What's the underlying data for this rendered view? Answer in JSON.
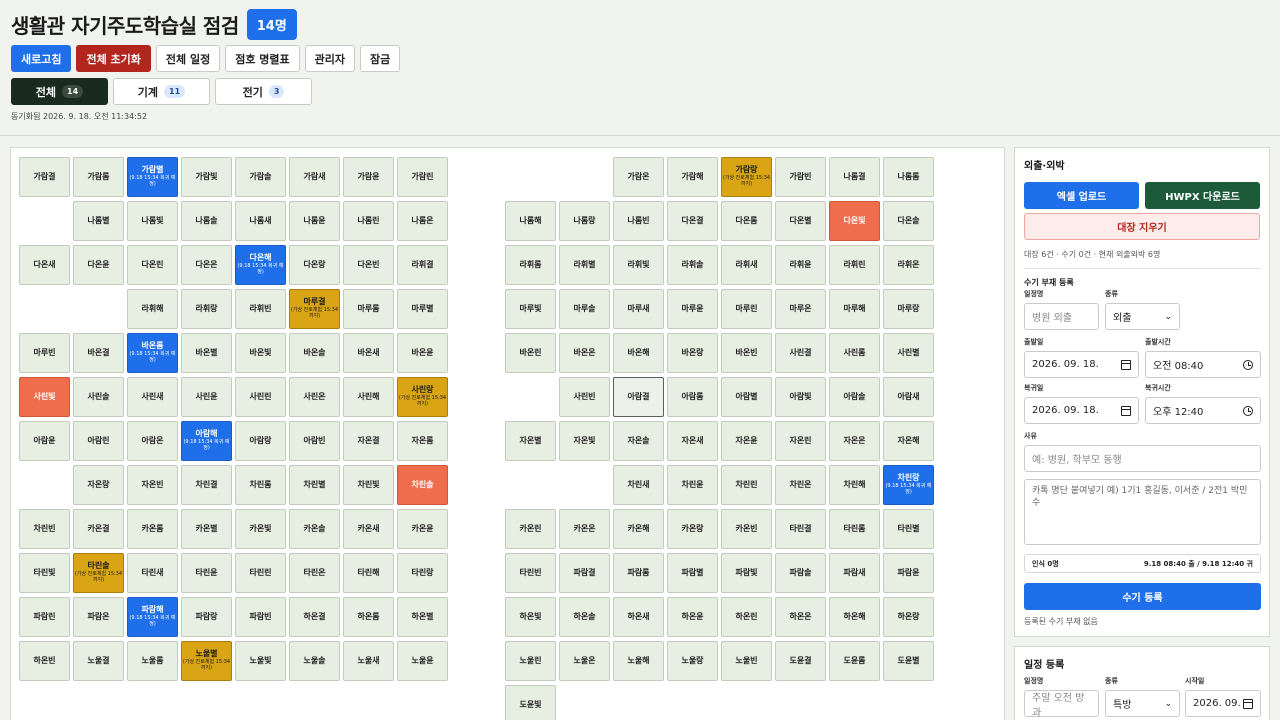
{
  "header": {
    "title": "생활관 자기주도학습실 점검",
    "count": "14명"
  },
  "toolbar": {
    "buttons": [
      "새로고침",
      "전체 초기화",
      "전체 일정",
      "점호 명렬표",
      "관리자",
      "잠금"
    ]
  },
  "filters": [
    {
      "label": "전체",
      "count": "14"
    },
    {
      "label": "기계",
      "count": "11"
    },
    {
      "label": "전기",
      "count": "3"
    }
  ],
  "sync_text": "동기화됨 2026. 9. 18. 오전 11:34:52",
  "seats": [
    {
      "n": "가람결"
    },
    {
      "n": "가람롬"
    },
    {
      "n": "가람별",
      "s": "blue",
      "sub": "(9.18 15:34 복귀 예정)"
    },
    {
      "n": "가람빛"
    },
    {
      "n": "가람솔"
    },
    {
      "n": "가람새"
    },
    {
      "n": "가람윤"
    },
    {
      "n": "가람린"
    },
    {
      "n": "가람온"
    },
    {
      "n": "가람해"
    },
    {
      "n": "가람랑",
      "s": "gold",
      "sub": "(가상 진로체험 15:34까지)"
    },
    {
      "n": "가람빈"
    },
    {
      "n": "나롬결"
    },
    {
      "n": "나롬롬"
    },
    {
      "n": "나롬별"
    },
    {
      "n": "나롬빛"
    },
    {
      "n": "나롬솔"
    },
    {
      "n": "나롬새"
    },
    {
      "n": "나롬윤"
    },
    {
      "n": "나롬린"
    },
    {
      "n": "나롬온"
    },
    {
      "n": "나롬해"
    },
    {
      "n": "나롬랑"
    },
    {
      "n": "나롬빈"
    },
    {
      "n": "다온결"
    },
    {
      "n": "다온롬"
    },
    {
      "n": "다온별"
    },
    {
      "n": "다온빛",
      "s": "coral"
    },
    {
      "n": "다온솔"
    },
    {
      "n": "다온새"
    },
    {
      "n": "다온윤"
    },
    {
      "n": "다온린"
    },
    {
      "n": "다온온"
    },
    {
      "n": "다온해",
      "s": "blue",
      "sub": "(9.18 15:34 복귀 예정)"
    },
    {
      "n": "다온랑"
    },
    {
      "n": "다온빈"
    },
    {
      "n": "라휘결"
    },
    {
      "n": "라휘롬"
    },
    {
      "n": "라휘별"
    },
    {
      "n": "라휘빛"
    },
    {
      "n": "라휘솔"
    },
    {
      "n": "라휘새"
    },
    {
      "n": "라휘윤"
    },
    {
      "n": "라휘린"
    },
    {
      "n": "라휘온"
    },
    {
      "n": "라휘해"
    },
    {
      "n": "라휘랑"
    },
    {
      "n": "라휘빈"
    },
    {
      "n": "마루결",
      "s": "gold",
      "sub": "(가상 진로체험 15:34까지)"
    },
    {
      "n": "마루롬"
    },
    {
      "n": "마루별"
    },
    {
      "n": "마루빛"
    },
    {
      "n": "마루솔"
    },
    {
      "n": "마루새"
    },
    {
      "n": "마루윤"
    },
    {
      "n": "마루린"
    },
    {
      "n": "마루온"
    },
    {
      "n": "마루해"
    },
    {
      "n": "마루랑"
    },
    {
      "n": "마루빈"
    },
    {
      "n": "바온결"
    },
    {
      "n": "바온롬",
      "s": "blue",
      "sub": "(9.18 15:34 복귀 예정)"
    },
    {
      "n": "바온별"
    },
    {
      "n": "바온빛"
    },
    {
      "n": "바온솔"
    },
    {
      "n": "바온새"
    },
    {
      "n": "바온윤"
    },
    {
      "n": "바온린"
    },
    {
      "n": "바온온"
    },
    {
      "n": "바온해"
    },
    {
      "n": "바온랑"
    },
    {
      "n": "바온빈"
    },
    {
      "n": "사린결"
    },
    {
      "n": "사린롬"
    },
    {
      "n": "사린별"
    },
    {
      "n": "사린빛",
      "s": "coral"
    },
    {
      "n": "사린솔"
    },
    {
      "n": "사린새"
    },
    {
      "n": "사린윤"
    },
    {
      "n": "사린린"
    },
    {
      "n": "사린온"
    },
    {
      "n": "사린해"
    },
    {
      "n": "사린랑",
      "s": "gold",
      "sub": "(가상 진로체험 15:34까지)"
    },
    {
      "n": "사린빈"
    },
    {
      "n": "아람결",
      "s": "out"
    },
    {
      "n": "아람롬"
    },
    {
      "n": "아람별"
    },
    {
      "n": "아람빛"
    },
    {
      "n": "아람솔"
    },
    {
      "n": "아람새"
    },
    {
      "n": "아람윤"
    },
    {
      "n": "아람린"
    },
    {
      "n": "아람온"
    },
    {
      "n": "아람해",
      "s": "blue",
      "sub": "(9.18 15:34 복귀 예정)"
    },
    {
      "n": "아람랑"
    },
    {
      "n": "아람빈"
    },
    {
      "n": "자온결"
    },
    {
      "n": "자온롬"
    },
    {
      "n": "자온별"
    },
    {
      "n": "자온빛"
    },
    {
      "n": "자온솔"
    },
    {
      "n": "자온새"
    },
    {
      "n": "자온윤"
    },
    {
      "n": "자온린"
    },
    {
      "n": "자온온"
    },
    {
      "n": "자온해"
    },
    {
      "n": "자온랑"
    },
    {
      "n": "자온빈"
    },
    {
      "n": "차린결"
    },
    {
      "n": "차린롬"
    },
    {
      "n": "차린별"
    },
    {
      "n": "차린빛"
    },
    {
      "n": "차린솔",
      "s": "coral"
    },
    {
      "n": "차린새"
    },
    {
      "n": "차린윤"
    },
    {
      "n": "차린린"
    },
    {
      "n": "차린온"
    },
    {
      "n": "차린해"
    },
    {
      "n": "차린랑",
      "s": "blue",
      "sub": "(9.18 15:34 복귀 예정)"
    },
    {
      "n": "차린빈"
    },
    {
      "n": "카온결"
    },
    {
      "n": "카온롬"
    },
    {
      "n": "카온별"
    },
    {
      "n": "카온빛"
    },
    {
      "n": "카온솔"
    },
    {
      "n": "카온새"
    },
    {
      "n": "카온윤"
    },
    {
      "n": "카온린"
    },
    {
      "n": "카온온"
    },
    {
      "n": "카온해"
    },
    {
      "n": "카온랑"
    },
    {
      "n": "카온빈"
    },
    {
      "n": "타린결"
    },
    {
      "n": "타린롬"
    },
    {
      "n": "타린별"
    },
    {
      "n": "타린빛"
    },
    {
      "n": "타린솔",
      "s": "gold",
      "sub": "(가상 진로체험 15:34까지)"
    },
    {
      "n": "타린새"
    },
    {
      "n": "타린윤"
    },
    {
      "n": "타린린"
    },
    {
      "n": "타린온"
    },
    {
      "n": "타린해"
    },
    {
      "n": "타린랑"
    },
    {
      "n": "타린빈"
    },
    {
      "n": "파람결"
    },
    {
      "n": "파람롬"
    },
    {
      "n": "파람별"
    },
    {
      "n": "파람빛"
    },
    {
      "n": "파람솔"
    },
    {
      "n": "파람새"
    },
    {
      "n": "파람윤"
    },
    {
      "n": "파람린"
    },
    {
      "n": "파람온"
    },
    {
      "n": "파람해",
      "s": "blue",
      "sub": "(9.18 15:34 복귀 예정)"
    },
    {
      "n": "파람랑"
    },
    {
      "n": "파람빈"
    },
    {
      "n": "하온결"
    },
    {
      "n": "하온롬"
    },
    {
      "n": "하온별"
    },
    {
      "n": "하온빛"
    },
    {
      "n": "하온솔"
    },
    {
      "n": "하온새"
    },
    {
      "n": "하온윤"
    },
    {
      "n": "하온린"
    },
    {
      "n": "하온온"
    },
    {
      "n": "하온해"
    },
    {
      "n": "하온랑"
    },
    {
      "n": "하온빈"
    },
    {
      "n": "노울결"
    },
    {
      "n": "노울롬"
    },
    {
      "n": "노울별",
      "s": "gold",
      "sub": "(가상 진로체험 15:34까지)"
    },
    {
      "n": "노울빛"
    },
    {
      "n": "노울솔"
    },
    {
      "n": "노울새"
    },
    {
      "n": "노울윤"
    },
    {
      "n": "노울린"
    },
    {
      "n": "노울온"
    },
    {
      "n": "노울해"
    },
    {
      "n": "노울랑"
    },
    {
      "n": "노울빈"
    },
    {
      "n": "도윤결"
    },
    {
      "n": "도윤롬"
    },
    {
      "n": "도윤별"
    },
    {
      "n": "도윤빛"
    }
  ],
  "outing": {
    "title": "외출·외박",
    "excel_label": "엑셀 업로드",
    "hwpx_label": "HWPX 다운로드",
    "clear_label": "대장 지우기",
    "summary": "대장 6건 · 수기 0건 · 현재 외출외박 6명",
    "manual_title": "수기 부재 등록",
    "event_label": "일정명",
    "event_placeholder": "병원 외출",
    "kind_label": "종류",
    "kind_value": "외출",
    "depart_date_label": "출발일",
    "depart_date": "2026. 09. 18.",
    "depart_time_label": "출발시간",
    "depart_time": "오전 08:40",
    "return_date_label": "복귀일",
    "return_date": "2026. 09. 18.",
    "return_time_label": "복귀시간",
    "return_time": "오후 12:40",
    "reason_label": "사유",
    "reason_placeholder": "예: 병원, 학부모 동행",
    "paste_placeholder": "카톡 명단 붙여넣기 예) 1기1 홍길동, 이서준 / 2전1 박민수",
    "recognized": "인식 0명",
    "recognized_range": "9.18 08:40 출 / 9.18 12:40 귀",
    "register_label": "수기 등록",
    "empty_note": "등록된 수기 부재 없음"
  },
  "schedule": {
    "title": "일정 등록",
    "event_label": "일정명",
    "event_placeholder": "주말 오전 방과",
    "kind_label": "종류",
    "kind_value": "특방",
    "start_label": "시작일",
    "start_value": "2026. 09."
  }
}
